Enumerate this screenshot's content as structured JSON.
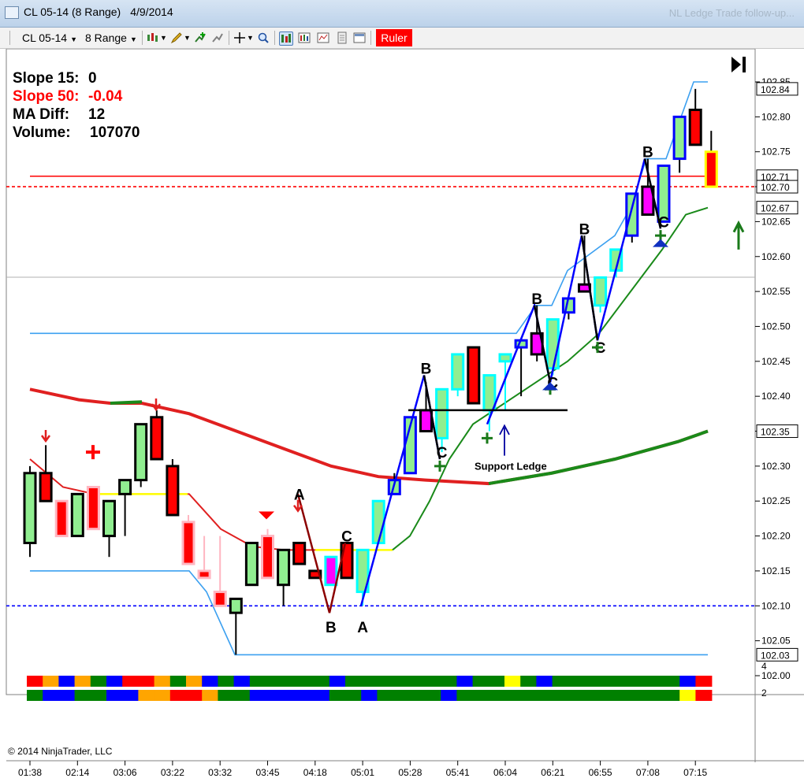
{
  "window": {
    "symbol": "CL 05-14 (8 Range)",
    "date": "4/9/2014",
    "background_title": "NL Ledge Trade follow-up..."
  },
  "toolbar": {
    "instrument": "CL 05-14",
    "interval": "8 Range",
    "ruler_label": "Ruler",
    "ruler_color": "#ff0000"
  },
  "info_panel": {
    "slope15_label": "Slope 15:",
    "slope15_value": "0",
    "slope50_label": "Slope 50:",
    "slope50_value": "-0.04",
    "madiff_label": "MA Diff:",
    "madiff_value": "12",
    "volume_label": "Volume:",
    "volume_value": "107070"
  },
  "copyright": "© 2014 NinjaTrader, LLC",
  "chart_data": {
    "type": "candlestick",
    "ylim": [
      101.96,
      102.865
    ],
    "y_ticks": [
      "102.85",
      "102.80",
      "102.75",
      "102.70",
      "102.65",
      "102.60",
      "102.55",
      "102.50",
      "102.45",
      "102.40",
      "102.35",
      "102.30",
      "102.25",
      "102.20",
      "102.15",
      "102.10",
      "102.05",
      "102.00"
    ],
    "price_badges": [
      {
        "label": "102.84",
        "value": 102.84,
        "color": "#ffffff"
      },
      {
        "label": "102.71",
        "value": 102.715,
        "color": "#ffffff"
      },
      {
        "label": "102.70",
        "value": 102.7,
        "color": "#ffffff"
      },
      {
        "label": "102.67",
        "value": 102.67,
        "color": "#ffffff"
      },
      {
        "label": "102.35",
        "value": 102.35,
        "color": "#ffffff"
      },
      {
        "label": "102.03",
        "value": 102.03,
        "color": "#ffffff"
      }
    ],
    "x_labels": [
      {
        "i": 0,
        "label": "01:38"
      },
      {
        "i": 3,
        "label": "02:14"
      },
      {
        "i": 6,
        "label": "03:06"
      },
      {
        "i": 9,
        "label": "03:22"
      },
      {
        "i": 12,
        "label": "03:32"
      },
      {
        "i": 15,
        "label": "03:45"
      },
      {
        "i": 18,
        "label": "04:18"
      },
      {
        "i": 21,
        "label": "05:01"
      },
      {
        "i": 24,
        "label": "05:28"
      },
      {
        "i": 27,
        "label": "05:41"
      },
      {
        "i": 30,
        "label": "06:04"
      },
      {
        "i": 33,
        "label": "06:21"
      },
      {
        "i": 36,
        "label": "06:55"
      },
      {
        "i": 39,
        "label": "07:08"
      },
      {
        "i": 42,
        "label": "07:15"
      }
    ],
    "bars": [
      {
        "o": 102.19,
        "h": 102.3,
        "l": 102.17,
        "c": 102.29,
        "fill": "#90ee90",
        "edge": "#000000"
      },
      {
        "o": 102.29,
        "h": 102.33,
        "l": 102.25,
        "c": 102.25,
        "fill": "#ff0000",
        "edge": "#000000"
      },
      {
        "o": 102.25,
        "h": 102.25,
        "l": 102.2,
        "c": 102.2,
        "fill": "#ff0000",
        "edge": "#ffb6c1"
      },
      {
        "o": 102.2,
        "h": 102.26,
        "l": 102.2,
        "c": 102.26,
        "fill": "#90ee90",
        "edge": "#000000"
      },
      {
        "o": 102.27,
        "h": 102.27,
        "l": 102.21,
        "c": 102.21,
        "fill": "#ff0000",
        "edge": "#ffb6c1"
      },
      {
        "o": 102.2,
        "h": 102.25,
        "l": 102.17,
        "c": 102.25,
        "fill": "#90ee90",
        "edge": "#000000"
      },
      {
        "o": 102.26,
        "h": 102.28,
        "l": 102.2,
        "c": 102.28,
        "fill": "#90ee90",
        "edge": "#000000"
      },
      {
        "o": 102.28,
        "h": 102.36,
        "l": 102.27,
        "c": 102.36,
        "fill": "#90ee90",
        "edge": "#000000"
      },
      {
        "o": 102.37,
        "h": 102.38,
        "l": 102.31,
        "c": 102.31,
        "fill": "#ff0000",
        "edge": "#000000"
      },
      {
        "o": 102.3,
        "h": 102.31,
        "l": 102.23,
        "c": 102.23,
        "fill": "#ff0000",
        "edge": "#000000"
      },
      {
        "o": 102.22,
        "h": 102.23,
        "l": 102.16,
        "c": 102.16,
        "fill": "#ff0000",
        "edge": "#ffb6c1"
      },
      {
        "o": 102.15,
        "h": 102.2,
        "l": 102.14,
        "c": 102.14,
        "fill": "#ff0000",
        "edge": "#ffb6c1"
      },
      {
        "o": 102.12,
        "h": 102.2,
        "l": 102.1,
        "c": 102.1,
        "fill": "#ff0000",
        "edge": "#ffb6c1"
      },
      {
        "o": 102.09,
        "h": 102.11,
        "l": 102.03,
        "c": 102.11,
        "fill": "#90ee90",
        "edge": "#000000"
      },
      {
        "o": 102.13,
        "h": 102.19,
        "l": 102.13,
        "c": 102.19,
        "fill": "#90ee90",
        "edge": "#000000"
      },
      {
        "o": 102.2,
        "h": 102.21,
        "l": 102.14,
        "c": 102.14,
        "fill": "#ff0000",
        "edge": "#ffb6c1"
      },
      {
        "o": 102.13,
        "h": 102.18,
        "l": 102.1,
        "c": 102.18,
        "fill": "#90ee90",
        "edge": "#000000"
      },
      {
        "o": 102.19,
        "h": 102.19,
        "l": 102.16,
        "c": 102.16,
        "fill": "#ff0000",
        "edge": "#000000"
      },
      {
        "o": 102.15,
        "h": 102.15,
        "l": 102.14,
        "c": 102.14,
        "fill": "#ff0000",
        "edge": "#000000"
      },
      {
        "o": 102.13,
        "h": 102.17,
        "l": 102.13,
        "c": 102.17,
        "fill": "#ff00ff",
        "edge": "#00ffff"
      },
      {
        "o": 102.14,
        "h": 102.19,
        "l": 102.14,
        "c": 102.19,
        "fill": "#ff0000",
        "edge": "#000000"
      },
      {
        "o": 102.12,
        "h": 102.18,
        "l": 102.1,
        "c": 102.18,
        "fill": "#90ee90",
        "edge": "#00ffff"
      },
      {
        "o": 102.19,
        "h": 102.25,
        "l": 102.19,
        "c": 102.25,
        "fill": "#90ee90",
        "edge": "#00ffff"
      },
      {
        "o": 102.26,
        "h": 102.29,
        "l": 102.26,
        "c": 102.28,
        "fill": "#90ee90",
        "edge": "#0000ff"
      },
      {
        "o": 102.29,
        "h": 102.37,
        "l": 102.29,
        "c": 102.37,
        "fill": "#90ee90",
        "edge": "#0000ff"
      },
      {
        "o": 102.35,
        "h": 102.42,
        "l": 102.35,
        "c": 102.38,
        "fill": "#ff00ff",
        "edge": "#000000"
      },
      {
        "o": 102.34,
        "h": 102.41,
        "l": 102.32,
        "c": 102.41,
        "fill": "#90ee90",
        "edge": "#00ffff"
      },
      {
        "o": 102.41,
        "h": 102.46,
        "l": 102.4,
        "c": 102.46,
        "fill": "#90ee90",
        "edge": "#00ffff"
      },
      {
        "o": 102.47,
        "h": 102.47,
        "l": 102.39,
        "c": 102.39,
        "fill": "#ff0000",
        "edge": "#000000"
      },
      {
        "o": 102.38,
        "h": 102.43,
        "l": 102.35,
        "c": 102.43,
        "fill": "#90ee90",
        "edge": "#00ffff"
      },
      {
        "o": 102.45,
        "h": 102.46,
        "l": 102.38,
        "c": 102.46,
        "fill": "#90ee90",
        "edge": "#00ffff"
      },
      {
        "o": 102.47,
        "h": 102.48,
        "l": 102.4,
        "c": 102.48,
        "fill": "#90ee90",
        "edge": "#0000ff"
      },
      {
        "o": 102.49,
        "h": 102.53,
        "l": 102.45,
        "c": 102.46,
        "fill": "#ff00ff",
        "edge": "#000000"
      },
      {
        "o": 102.44,
        "h": 102.51,
        "l": 102.43,
        "c": 102.51,
        "fill": "#90ee90",
        "edge": "#00ffff"
      },
      {
        "o": 102.52,
        "h": 102.54,
        "l": 102.51,
        "c": 102.54,
        "fill": "#90ee90",
        "edge": "#0000ff"
      },
      {
        "o": 102.56,
        "h": 102.63,
        "l": 102.55,
        "c": 102.55,
        "fill": "#ff00ff",
        "edge": "#000000"
      },
      {
        "o": 102.53,
        "h": 102.57,
        "l": 102.52,
        "c": 102.57,
        "fill": "#90ee90",
        "edge": "#00ffff"
      },
      {
        "o": 102.58,
        "h": 102.61,
        "l": 102.57,
        "c": 102.61,
        "fill": "#90ee90",
        "edge": "#00ffff"
      },
      {
        "o": 102.63,
        "h": 102.69,
        "l": 102.62,
        "c": 102.69,
        "fill": "#90ee90",
        "edge": "#0000ff"
      },
      {
        "o": 102.7,
        "h": 102.74,
        "l": 102.66,
        "c": 102.66,
        "fill": "#ff00ff",
        "edge": "#000000"
      },
      {
        "o": 102.65,
        "h": 102.73,
        "l": 102.65,
        "c": 102.73,
        "fill": "#90ee90",
        "edge": "#0000ff"
      },
      {
        "o": 102.74,
        "h": 102.8,
        "l": 102.72,
        "c": 102.8,
        "fill": "#90ee90",
        "edge": "#0000ff"
      },
      {
        "o": 102.81,
        "h": 102.84,
        "l": 102.76,
        "c": 102.76,
        "fill": "#ff0000",
        "edge": "#000000"
      },
      {
        "o": 102.75,
        "h": 102.78,
        "l": 102.7,
        "c": 102.7,
        "fill": "#ff0000",
        "edge": "#ffff00"
      }
    ],
    "horizontal_lines": [
      {
        "value": 102.715,
        "color": "#ff0000",
        "style": "solid"
      },
      {
        "value": 102.7,
        "color": "#ff0000",
        "style": "dashed"
      },
      {
        "value": 102.1,
        "color": "#0000ff",
        "style": "dashed"
      }
    ],
    "support_ledge": {
      "value": 102.38,
      "label": "Support Ledge"
    },
    "abc_labels": [
      {
        "i": 17,
        "v": 102.26,
        "t": "A"
      },
      {
        "i": 19,
        "v": 102.07,
        "t": "B"
      },
      {
        "i": 20,
        "v": 102.2,
        "t": "C"
      },
      {
        "i": 21,
        "v": 102.07,
        "t": "A"
      },
      {
        "i": 25,
        "v": 102.44,
        "t": "B"
      },
      {
        "i": 26,
        "v": 102.32,
        "t": "C"
      },
      {
        "i": 32,
        "v": 102.54,
        "t": "B"
      },
      {
        "i": 33,
        "v": 102.42,
        "t": "C"
      },
      {
        "i": 35,
        "v": 102.64,
        "t": "B"
      },
      {
        "i": 36,
        "v": 102.47,
        "t": "C"
      },
      {
        "i": 39,
        "v": 102.75,
        "t": "B"
      },
      {
        "i": 40,
        "v": 102.65,
        "t": "C"
      }
    ],
    "volume_panel": {
      "ylim": [
        1,
        5
      ],
      "y_ticks": [
        "4",
        "2"
      ]
    }
  }
}
